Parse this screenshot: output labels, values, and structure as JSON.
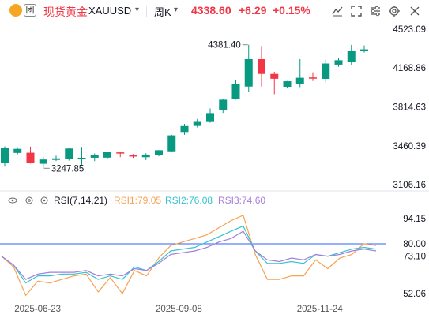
{
  "header": {
    "title": "现货黄金",
    "symbol": "XAUUSD",
    "interval": "周K",
    "price": "4338.60",
    "change": "+6.29",
    "change_pct": "+0.15%",
    "up_color": "#f23645",
    "down_color": "#089981"
  },
  "icons": [
    "gold-coin-icon",
    "tuan-logo-icon",
    "dropdown-caret-icon",
    "dropdown-caret-icon",
    "line-tool-icon",
    "fullscreen-icon",
    "indicator-icon",
    "settings-icon",
    "close-icon"
  ],
  "chart_data": [
    {
      "type": "candlestick",
      "title": "现货黄金 XAUUSD 周K",
      "y_axis_labels": [
        "4523.09",
        "4168.86",
        "3814.63",
        "3460.39",
        "3106.16"
      ],
      "ylim": [
        3106.16,
        4523.09
      ],
      "annotations": [
        {
          "text": "4381.40"
        },
        {
          "text": "3247.85"
        }
      ],
      "candles": [
        {
          "o": 3303,
          "h": 3455,
          "l": 3270,
          "c": 3442
        },
        {
          "o": 3395,
          "h": 3445,
          "l": 3383,
          "c": 3432
        },
        {
          "o": 3397,
          "h": 3452,
          "l": 3298,
          "c": 3307
        },
        {
          "o": 3296,
          "h": 3360,
          "l": 3255,
          "c": 3335
        },
        {
          "o": 3331,
          "h": 3370,
          "l": 3320,
          "c": 3345
        },
        {
          "o": 3340,
          "h": 3445,
          "l": 3325,
          "c": 3435
        },
        {
          "o": 3336,
          "h": 3450,
          "l": 3285,
          "c": 3351
        },
        {
          "o": 3351,
          "h": 3390,
          "l": 3320,
          "c": 3375
        },
        {
          "o": 3352,
          "h": 3395,
          "l": 3345,
          "c": 3402
        },
        {
          "o": 3400,
          "h": 3405,
          "l": 3356,
          "c": 3398
        },
        {
          "o": 3379,
          "h": 3385,
          "l": 3350,
          "c": 3362
        },
        {
          "o": 3356,
          "h": 3392,
          "l": 3330,
          "c": 3380
        },
        {
          "o": 3375,
          "h": 3420,
          "l": 3365,
          "c": 3420
        },
        {
          "o": 3410,
          "h": 3560,
          "l": 3400,
          "c": 3555
        },
        {
          "o": 3586,
          "h": 3660,
          "l": 3560,
          "c": 3640
        },
        {
          "o": 3641,
          "h": 3705,
          "l": 3627,
          "c": 3685
        },
        {
          "o": 3684,
          "h": 3800,
          "l": 3670,
          "c": 3758
        },
        {
          "o": 3783,
          "h": 3890,
          "l": 3760,
          "c": 3880
        },
        {
          "o": 3887,
          "h": 4060,
          "l": 3880,
          "c": 4020
        },
        {
          "o": 4000,
          "h": 4381.4,
          "l": 3950,
          "c": 4250
        },
        {
          "o": 4250,
          "h": 4370,
          "l": 4000,
          "c": 4115
        },
        {
          "o": 4115,
          "h": 4135,
          "l": 3930,
          "c": 4071
        },
        {
          "o": 3998,
          "h": 4050,
          "l": 3985,
          "c": 4048
        },
        {
          "o": 4020,
          "h": 4250,
          "l": 3995,
          "c": 4080
        },
        {
          "o": 4083,
          "h": 4130,
          "l": 4050,
          "c": 4072
        },
        {
          "o": 4070,
          "h": 4245,
          "l": 4040,
          "c": 4210
        },
        {
          "o": 4200,
          "h": 4260,
          "l": 4180,
          "c": 4240
        },
        {
          "o": 4225,
          "h": 4380,
          "l": 4200,
          "c": 4322
        },
        {
          "o": 4325,
          "h": 4375,
          "l": 4310,
          "c": 4339
        }
      ],
      "x_labels": [
        {
          "text": "2025-06-23",
          "index": 1
        },
        {
          "text": "2025-09-08",
          "index": 12
        },
        {
          "text": "2025-11-24",
          "index": 23
        }
      ]
    },
    {
      "type": "line",
      "title": "RSI(7,14,21)",
      "y_axis_labels": [
        "94.15",
        "73.10",
        "52.06"
      ],
      "ylim": [
        52.06,
        94.15
      ],
      "reference_line": {
        "value": 80.0,
        "label": "80.00"
      },
      "series": [
        {
          "name": "RSI1:79.05",
          "color": "#f7a24f",
          "values": [
            73,
            67,
            51,
            59,
            58,
            60,
            62,
            63,
            53,
            61,
            52,
            65,
            62,
            72,
            79,
            81,
            83,
            85,
            89,
            93,
            96,
            74,
            60,
            60,
            62,
            62,
            71,
            66,
            72,
            74,
            80,
            79
          ]
        },
        {
          "name": "RSI2:76.08",
          "color": "#34c3d0",
          "values": [
            73,
            68,
            58,
            62,
            62,
            63,
            63,
            64,
            60,
            62,
            60,
            67,
            65,
            70,
            76,
            77,
            78,
            81,
            84,
            87,
            90,
            76,
            69,
            69,
            70,
            69,
            74,
            73,
            75,
            77,
            78,
            77
          ]
        },
        {
          "name": "RSI3:74.60",
          "color": "#a57edb",
          "values": [
            73,
            68,
            60,
            63,
            64,
            64,
            64,
            65,
            62,
            63,
            62,
            66,
            65,
            69,
            74,
            75,
            76,
            78,
            81,
            83,
            87,
            76,
            71,
            70,
            72,
            71,
            74,
            73,
            74,
            76,
            77,
            76
          ]
        }
      ],
      "x_labels": [
        "2025-06-23",
        "2025-09-08",
        "2025-11-24"
      ]
    }
  ]
}
